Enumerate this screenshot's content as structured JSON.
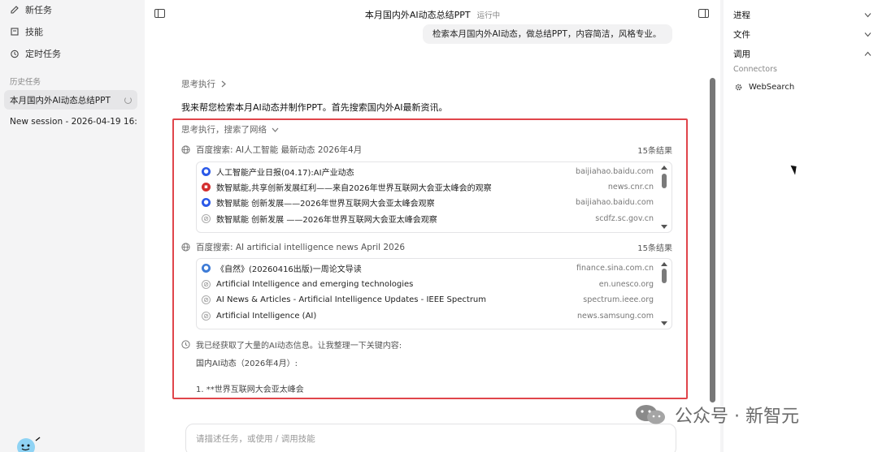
{
  "sidebar": {
    "nav": [
      {
        "label": "新任务",
        "icon": "edit-icon"
      },
      {
        "label": "技能",
        "icon": "skills-icon"
      },
      {
        "label": "定时任务",
        "icon": "clock-icon"
      }
    ],
    "history_label": "历史任务",
    "sessions": [
      {
        "label": "本月国内外AI动态总结PPT",
        "active": true
      },
      {
        "label": "New session - 2026-04-19 16:..."
      }
    ]
  },
  "main": {
    "title": "本月国内外AI动态总结PPT",
    "status": "运行中",
    "user_message": "检索本月国内外AI动态，做总结PPT，内容简洁，风格专业。",
    "thinking_label": "思考执行",
    "assistant_text": "我来帮您检索本月AI动态并制作PPT。首先搜索国内外AI最新资讯。",
    "search_group_label": "思考执行，搜索了网络",
    "searches": [
      {
        "query": "百度搜索: AI人工智能 最新动态 2026年4月",
        "count": "15条结果",
        "results": [
          {
            "title": "人工智能产业日报(04.17):AI产业动态",
            "domain": "baijiahao.baidu.com",
            "icon": "baidu-paw-icon"
          },
          {
            "title": "数智赋能,共享创新发展红利——来自2026年世界互联网大会亚太峰会的观察",
            "domain": "news.cnr.cn",
            "icon": "cnr-icon"
          },
          {
            "title": "数智赋能 创新发展——2026年世界互联网大会亚太峰会观察",
            "domain": "baijiahao.baidu.com",
            "icon": "baidu-paw-icon"
          },
          {
            "title": "数智赋能 创新发展 ——2026年世界互联网大会亚太峰会观察",
            "domain": "scdfz.sc.gov.cn",
            "icon": "link-icon"
          }
        ]
      },
      {
        "query": "百度搜索: AI artificial intelligence news April 2026",
        "count": "15条结果",
        "results": [
          {
            "title": "《自然》(20260416出版)一周论文导读",
            "domain": "finance.sina.com.cn",
            "icon": "sina-icon"
          },
          {
            "title": "Artificial Intelligence and emerging technologies",
            "domain": "en.unesco.org",
            "icon": "link-icon"
          },
          {
            "title": "AI News & Articles - Artificial Intelligence Updates - IEEE Spectrum",
            "domain": "spectrum.ieee.org",
            "icon": "link-icon"
          },
          {
            "title": "Artificial Intelligence (AI)",
            "domain": "news.samsung.com",
            "icon": "link-icon"
          }
        ]
      }
    ],
    "summary_head": "我已经获取了大量的AI动态信息。让我整理一下关键内容:",
    "summary_lines": [
      "国内AI动态（2026年4月）:",
      "1. **世界互联网大会亚太峰会"
    ],
    "input_placeholder": "请描述任务，或使用 / 调用技能"
  },
  "right_panel": {
    "sections": [
      {
        "label": "进程",
        "expanded": false
      },
      {
        "label": "文件",
        "expanded": false
      },
      {
        "label": "调用",
        "expanded": true
      }
    ],
    "connectors_label": "Connectors",
    "connector": "WebSearch"
  },
  "watermark": "公众号 · 新智元",
  "colors": {
    "highlight": "#e0454b",
    "baidu": "#2b59e8",
    "cnr": "#d32f2f"
  }
}
